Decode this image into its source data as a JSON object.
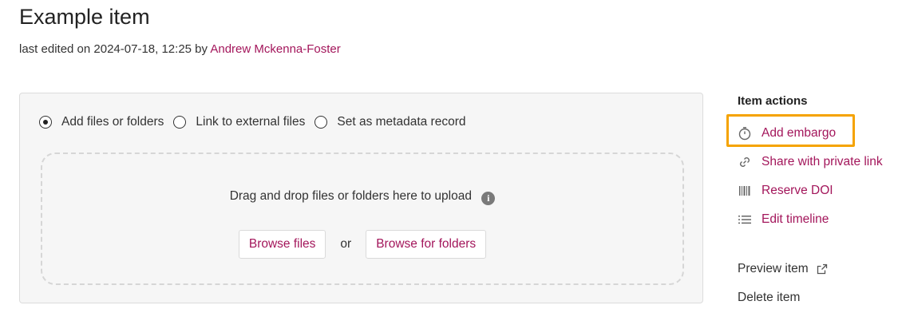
{
  "item": {
    "title": "Example item",
    "edited_prefix": "last edited on 2024-07-18, 12:25 by",
    "editor_name": "Andrew Mckenna-Foster"
  },
  "upload": {
    "options": [
      {
        "label": "Add files or folders",
        "selected": true
      },
      {
        "label": "Link to external files",
        "selected": false
      },
      {
        "label": "Set as metadata record",
        "selected": false
      }
    ],
    "drop_text": "Drag and drop files or folders here to upload",
    "info_glyph": "i",
    "browse_files": "Browse files",
    "or": "or",
    "browse_folders": "Browse for folders"
  },
  "actions": {
    "title": "Item actions",
    "items": [
      {
        "label": "Add embargo",
        "icon": "stopwatch-icon"
      },
      {
        "label": "Share with private link",
        "icon": "link-icon"
      },
      {
        "label": "Reserve DOI",
        "icon": "barcode-icon"
      },
      {
        "label": "Edit timeline",
        "icon": "list-icon"
      }
    ],
    "preview": "Preview item",
    "delete": "Delete item"
  },
  "colors": {
    "link": "#a3165b",
    "highlight": "#f5a300"
  }
}
